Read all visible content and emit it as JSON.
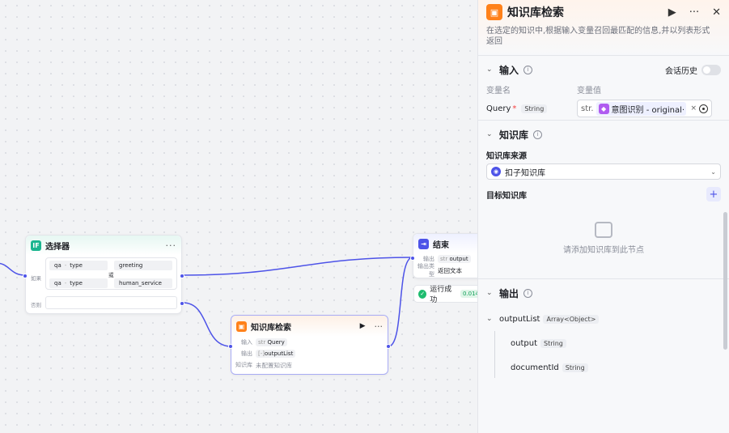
{
  "canvas": {
    "selector_node": {
      "title": "选择器",
      "icon": "IF",
      "if_label": "如果",
      "or_label": "或",
      "else_label": "否则",
      "conditions": [
        {
          "var": "qa",
          "field": "type",
          "value": "greeting"
        },
        {
          "var": "qa",
          "field": "type",
          "value": "human_service"
        }
      ]
    },
    "kb_node": {
      "title": "知识库检索",
      "input_label": "输入",
      "input_type": "str",
      "input_value": "Query",
      "output_label": "输出",
      "output_type": "[-]",
      "output_value": "outputList",
      "kb_label": "知识库",
      "kb_value": "未配置知识库"
    },
    "end_node": {
      "title": "结束",
      "output_label": "输出",
      "output_type": "str",
      "output_value": "output",
      "output_kind_label": "输出类型",
      "output_kind_value": "返回文本"
    },
    "run_status": {
      "label": "运行成功",
      "time": "0.014"
    }
  },
  "panel": {
    "title": "知识库检索",
    "description": "在选定的知识中,根据输入变量召回最匹配的信息,并以列表形式返回",
    "input_section": {
      "title": "输入",
      "history_label": "会话历史",
      "col_name": "变量名",
      "col_value": "变量值",
      "var_name": "Query",
      "var_type": "String",
      "value_prefix": "str.",
      "ref_text": "意图识别 - original···"
    },
    "kb_section": {
      "title": "知识库",
      "source_label": "知识库来源",
      "source_value": "扣子知识库",
      "target_label": "目标知识库",
      "empty_text": "请添加知识库到此节点"
    },
    "output_section": {
      "title": "输出",
      "root_name": "outputList",
      "root_type": "Array<Object>",
      "children": [
        {
          "name": "output",
          "type": "String"
        },
        {
          "name": "documentId",
          "type": "String"
        }
      ]
    }
  }
}
